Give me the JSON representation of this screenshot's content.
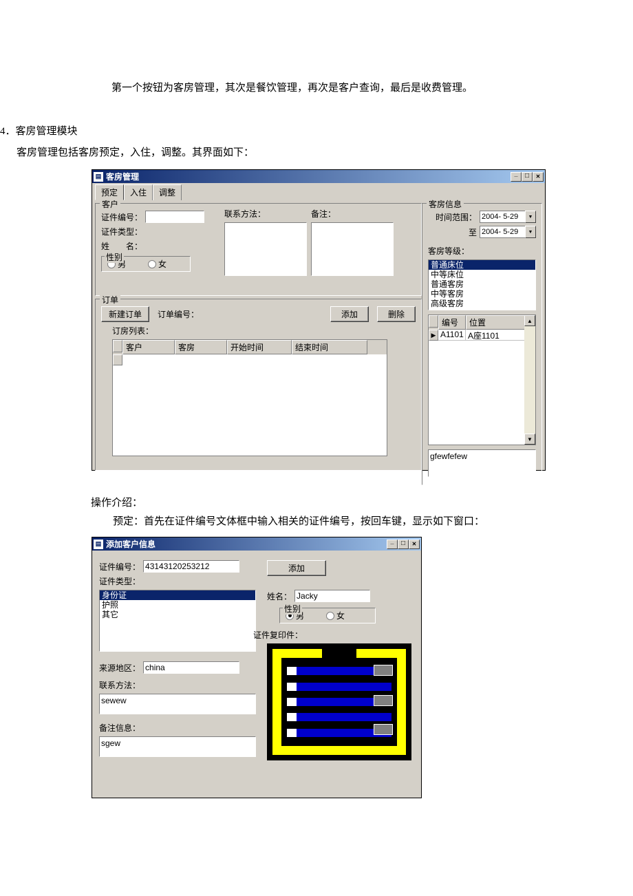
{
  "doc": {
    "para1": "第一个按钮为客房管理，其次是餐饮管理，再次是客户查询，最后是收费管理。",
    "list_num": "4．",
    "list_title": "客房管理模块",
    "list_body": "客房管理包括客房预定，入住，调整。其界面如下：",
    "para2": "操作介绍：",
    "para3": "预定：首先在证件编号文体框中输入相关的证件编号，按回车键，显示如下窗口："
  },
  "win1": {
    "title": "客房管理",
    "tabs": [
      "预定",
      "入住",
      "调整"
    ],
    "customer": {
      "legend": "客户",
      "id_no_lbl": "证件编号：",
      "id_type_lbl": "证件类型：",
      "name_lbl": "姓　　名：",
      "contact_lbl": "联系方法：",
      "remark_lbl": "备注：",
      "gender_legend": "性别",
      "male": "男",
      "female": "女"
    },
    "order": {
      "legend": "订单",
      "new_btn": "新建订单",
      "order_no_lbl": "订单编号：",
      "add_btn": "添加",
      "del_btn": "删除",
      "list_lbl": "订房列表：",
      "cols": [
        "客户",
        "客房",
        "开始时间",
        "结束时间"
      ]
    },
    "roominfo": {
      "legend": "客房信息",
      "range_lbl": "时间范围：",
      "to_lbl": "至",
      "date1": "2004- 5-29",
      "date2": "2004- 5-29",
      "level_lbl": "客房等级：",
      "levels": [
        "普通床位",
        "中等床位",
        "普通客房",
        "中等客房",
        "高级客房"
      ],
      "level_selected": 0,
      "grid_cols": [
        "编号",
        "位置"
      ],
      "grid_row": {
        "id": "A1101",
        "loc": "A座1101"
      },
      "memo": "gfewfefew"
    }
  },
  "win2": {
    "title": "添加客户信息",
    "id_no_lbl": "证件编号：",
    "id_no": "43143120253212",
    "id_type_lbl": "证件类型：",
    "types": [
      "身份证",
      "护照",
      "其它"
    ],
    "type_selected": 0,
    "region_lbl": "来源地区：",
    "region": "china",
    "contact_lbl": "联系方法：",
    "contact": "sewew",
    "remark_lbl": "备注信息：",
    "remark": "sgew",
    "add_btn": "添加",
    "name_lbl": "姓名：",
    "name": "Jacky",
    "gender_legend": "性别",
    "male": "男",
    "female": "女",
    "copy_lbl": "证件复印件："
  }
}
